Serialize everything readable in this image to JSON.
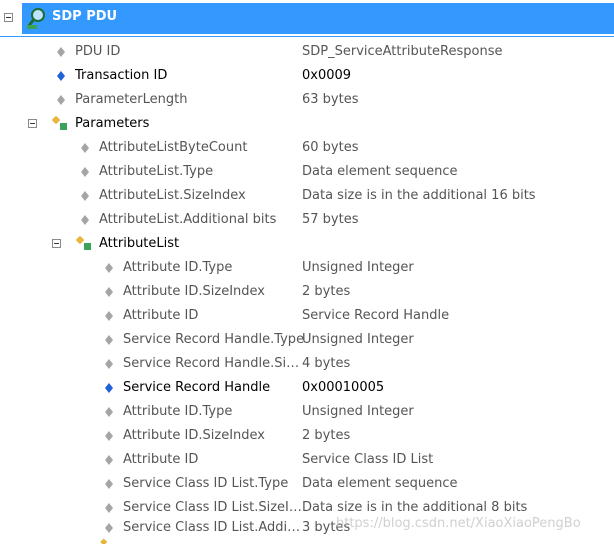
{
  "header": {
    "title": "SDP PDU"
  },
  "rows": [
    {
      "label": "PDU ID",
      "value": "SDP_ServiceAttributeResponse"
    },
    {
      "label": "Transaction ID",
      "value": "0x0009"
    },
    {
      "label": "ParameterLength",
      "value": "63 bytes"
    },
    {
      "label": "Parameters",
      "value": ""
    },
    {
      "label": "AttributeListByteCount",
      "value": "60 bytes"
    },
    {
      "label": "AttributeList.Type",
      "value": "Data element sequence"
    },
    {
      "label": "AttributeList.SizeIndex",
      "value": "Data size is in the additional 16 bits"
    },
    {
      "label": "AttributeList.Additional bits",
      "value": "57 bytes"
    },
    {
      "label": "AttributeList",
      "value": ""
    },
    {
      "label": "Attribute ID.Type",
      "value": "Unsigned Integer"
    },
    {
      "label": "Attribute ID.SizeIndex",
      "value": "2 bytes"
    },
    {
      "label": "Attribute ID",
      "value": "Service Record Handle"
    },
    {
      "label": "Service Record Handle.Type",
      "value": "Unsigned Integer"
    },
    {
      "label": "Service Record Handle.Si…",
      "value": "4 bytes"
    },
    {
      "label": "Service Record Handle",
      "value": "0x00010005"
    },
    {
      "label": "Attribute ID.Type",
      "value": "Unsigned Integer"
    },
    {
      "label": "Attribute ID.SizeIndex",
      "value": "2 bytes"
    },
    {
      "label": "Attribute ID",
      "value": "Service Class ID List"
    },
    {
      "label": "Service Class ID List.Type",
      "value": "Data element sequence"
    },
    {
      "label": "Service Class ID List.SizeI…",
      "value": "Data size is in the additional 8 bits"
    },
    {
      "label": "Service Class ID List.Addi…",
      "value": "3 bytes"
    }
  ],
  "watermark": "https://blog.csdn.net/XiaoXiaoPengBo",
  "colors": {
    "selection": "#3399ff",
    "prop_gray": "#9a9a9a",
    "prop_blue": "#1e63d6",
    "group_gold": "#e7b53b"
  }
}
